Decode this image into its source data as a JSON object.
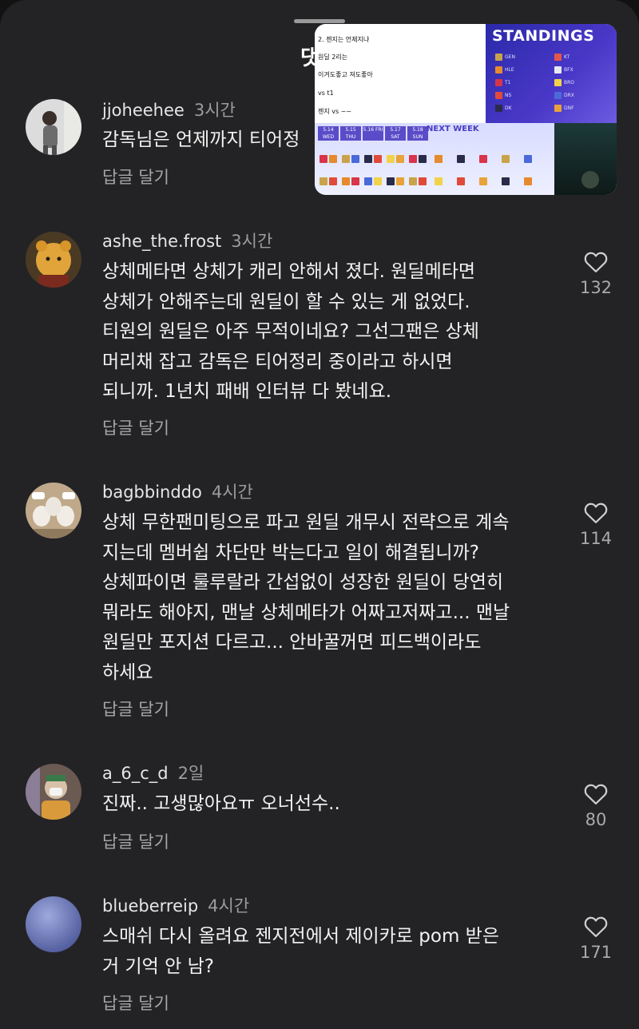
{
  "sheet": {
    "title": "댓"
  },
  "pip": {
    "notes": [
      "2. 젠지는 언제지냐",
      "원딜 2리는",
      "이겨도좋고 져도좋아",
      "vs t1",
      "젠지 vs ~~"
    ],
    "standings_title": "STANDINGS",
    "teams": [
      "GEN",
      "HLE",
      "T1",
      "NS",
      "DK"
    ],
    "teams_right": [
      "KT",
      "BFX",
      "BRO",
      "DRX",
      "DNF"
    ],
    "next_week": "NEXT WEEK",
    "days": [
      "5.14 WED",
      "5.15 THU",
      "5.16 FRI",
      "5.17 SAT",
      "5.18 SUN"
    ]
  },
  "comments": [
    {
      "username": "jjoheehee",
      "time": "3시간",
      "text": "감독님은 언제까지 티어정",
      "reply": "답글 달기",
      "likes": ""
    },
    {
      "username": "ashe_the.frost",
      "time": "3시간",
      "text": "상체메타면 상체가 캐리 안해서 졌다. 원딜메타면\n상체가 안해주는데 원딜이 할 수 있는 게 없었다.\n티원의 원딜은 아주 무적이네요? 그선그팬은 상체\n머리채 잡고 감독은 티어정리 중이라고 하시면\n되니까. 1년치 패배 인터뷰 다 봤네요.",
      "reply": "답글 달기",
      "likes": "132"
    },
    {
      "username": "bagbbinddo",
      "time": "4시간",
      "text": "상체 무한팬미팅으로 파고 원딜 개무시 전략으로 계속\n지는데 멤버쉽 차단만 박는다고 일이 해결됩니까?\n상체파이면 룰루랄라 간섭없이 성장한 원딜이 당연히\n뭐라도 해야지, 맨날 상체메타가 어짜고저짜고... 맨날\n원딜만 포지션 다르고... 안바꿀꺼면 피드백이라도\n하세요",
      "reply": "답글 달기",
      "likes": "114"
    },
    {
      "username": "a_6_c_d",
      "time": "2일",
      "text": "진짜.. 고생많아요ㅠ 오너선수..",
      "reply": "답글 달기",
      "likes": "80"
    },
    {
      "username": "blueberreip",
      "time": "4시간",
      "text": "스매쉬 다시 올려요 젠지전에서 제이카로 pom 받은\n거 기억 안 남?",
      "reply": "답글 달기",
      "likes": "171"
    }
  ],
  "colors": {
    "sheet_bg": "#232325",
    "text_primary": "#f2f2f2",
    "text_secondary": "#a6a6a6",
    "standings_bg": "#3a32b8"
  },
  "icons": [
    "heart-icon"
  ]
}
